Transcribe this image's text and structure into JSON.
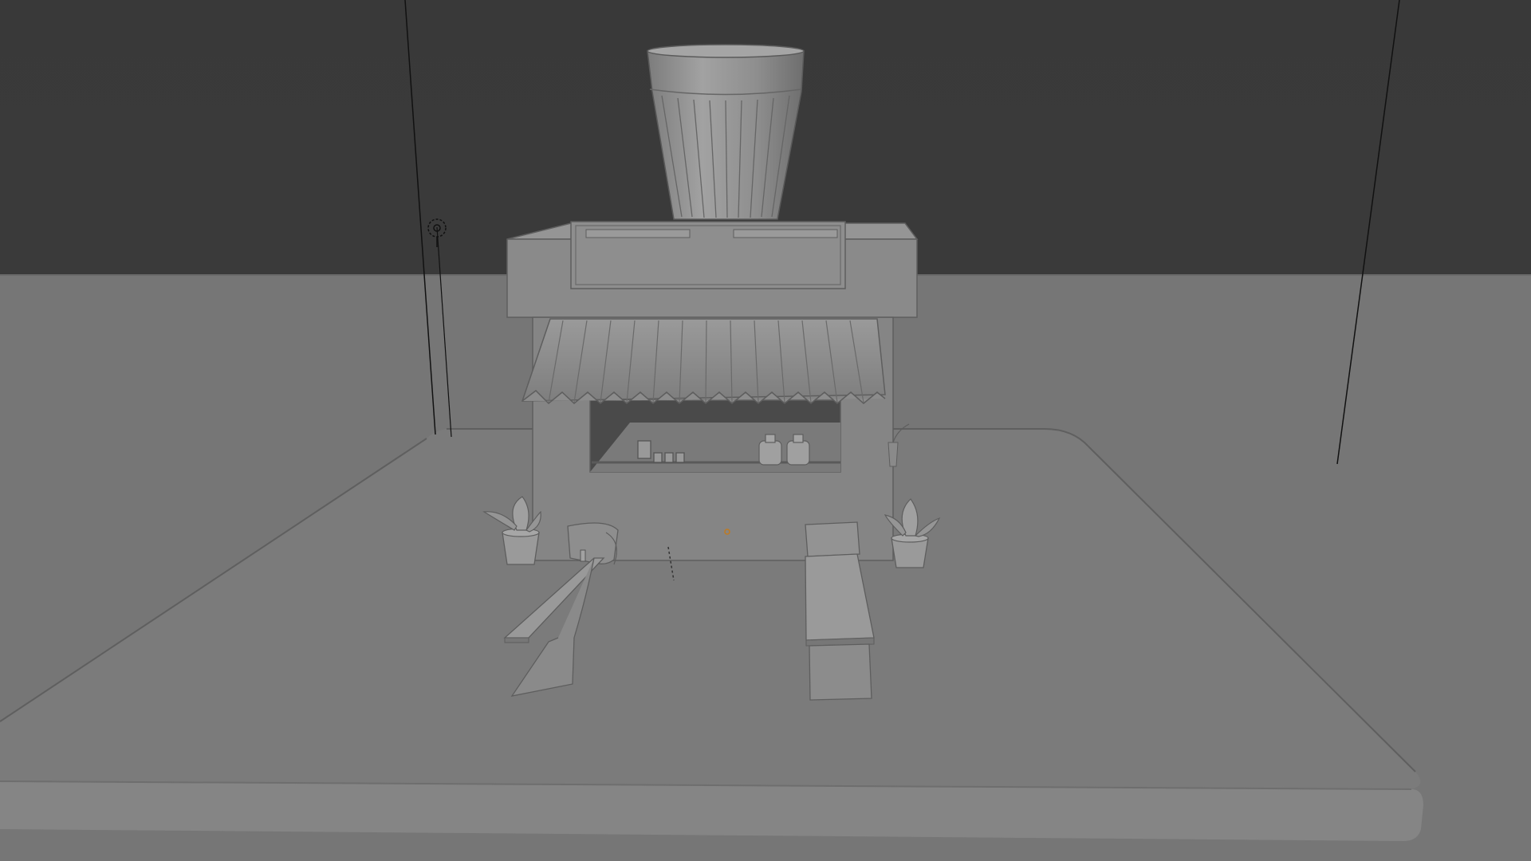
{
  "viewport": {
    "mode": "solid-shading",
    "background_color": "#3a3a3a",
    "ground_color": "#7a7a7a",
    "model_color": "#8a8a8a"
  },
  "scene": {
    "objects": [
      "ground-plane",
      "platform",
      "kiosk",
      "cup-sign",
      "awning",
      "benches",
      "plant-pots",
      "bottles",
      "light-object",
      "camera-lines"
    ]
  }
}
